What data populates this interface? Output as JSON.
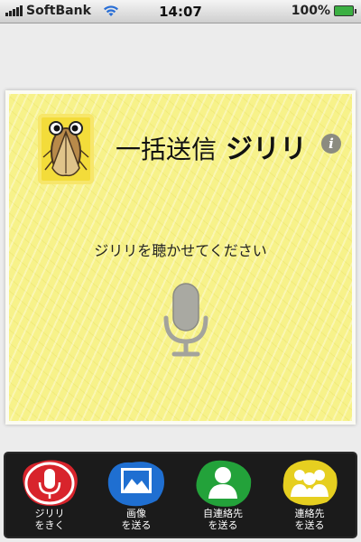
{
  "status_bar": {
    "carrier": "SoftBank",
    "time": "14:07",
    "battery": "100%"
  },
  "header": {
    "title": "一括送信",
    "brand": "ジリリ",
    "info_icon": "info-icon"
  },
  "main": {
    "prompt": "ジリリを聴かせてください",
    "mic_icon": "microphone-icon"
  },
  "toolbar": {
    "items": [
      {
        "label": "ジリリ\nをきく",
        "icon": "microphone-icon",
        "color": "#d8242c"
      },
      {
        "label": "画像\nを送る",
        "icon": "image-icon",
        "color": "#1f6fd1"
      },
      {
        "label": "自連絡先\nを送る",
        "icon": "person-icon",
        "color": "#23a23a"
      },
      {
        "label": "連絡先\nを送る",
        "icon": "group-icon",
        "color": "#e6cf20"
      }
    ]
  },
  "colors": {
    "card_yellow": "#f7f28a",
    "toolbar_bg": "#1b1b1b"
  }
}
